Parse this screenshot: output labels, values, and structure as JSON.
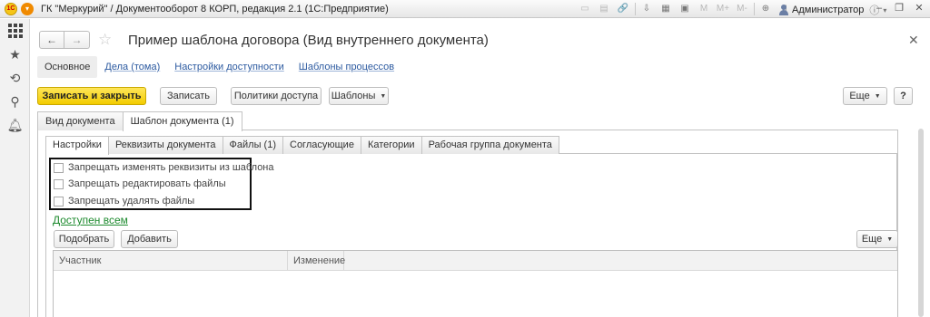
{
  "window": {
    "title": "ГК \"Меркурий\" / Документооборот 8 КОРП, редакция 2.1  (1С:Предприятие)",
    "user": "Администратор",
    "logo_text": "1С"
  },
  "toolbar_icons": [
    "print-icon",
    "save-icon",
    "link-icon",
    "attach-icon",
    "calculator-icon",
    "calendar-icon",
    "memory-m-icon",
    "memory-m-plus-icon",
    "memory-m-minus-icon",
    "zoom-icon",
    "panel-icon"
  ],
  "toolbar_labels": {
    "m": "M",
    "m_plus": "M+",
    "m_minus": "M-"
  },
  "form": {
    "title": "Пример шаблона договора (Вид внутреннего документа)",
    "nav": [
      {
        "label": "Основное",
        "active": true
      },
      {
        "label": "Дела (тома)"
      },
      {
        "label": "Настройки доступности"
      },
      {
        "label": "Шаблоны процессов"
      }
    ]
  },
  "commands": {
    "save_close": "Записать и закрыть",
    "save": "Записать",
    "access_policies": "Политики доступа",
    "templates": "Шаблоны",
    "more": "Еще",
    "help": "?"
  },
  "tabs_top": [
    {
      "label": "Вид документа"
    },
    {
      "label": "Шаблон документа (1)",
      "active": true
    }
  ],
  "tabs_inner": [
    {
      "label": "Настройки",
      "active": true
    },
    {
      "label": "Реквизиты документа"
    },
    {
      "label": "Файлы (1)"
    },
    {
      "label": "Согласующие"
    },
    {
      "label": "Категории"
    },
    {
      "label": "Рабочая группа документа"
    }
  ],
  "checkboxes": [
    {
      "label": "Запрещать изменять реквизиты из шаблона",
      "checked": false
    },
    {
      "label": "Запрещать редактировать файлы",
      "checked": false
    },
    {
      "label": "Запрещать удалять файлы",
      "checked": false
    }
  ],
  "access_link": "Доступен всем",
  "table_commands": {
    "pick": "Подобрать",
    "add": "Добавить",
    "more": "Еще"
  },
  "table": {
    "columns": [
      "Участник",
      "Изменение"
    ]
  },
  "colors": {
    "primary_button": "#f5d000",
    "link": "#2c5aa0",
    "access_link": "#1d8a2e"
  }
}
